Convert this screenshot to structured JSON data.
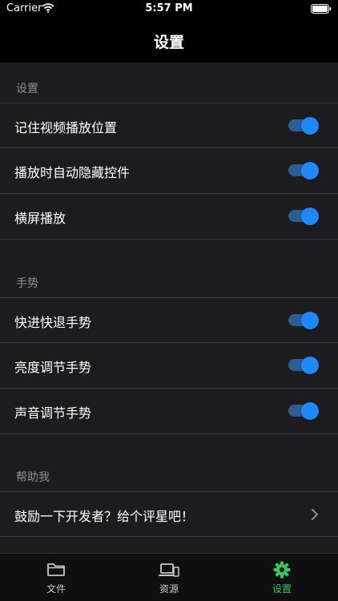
{
  "status_bar": {
    "carrier": "Carrier",
    "time": "5:57 PM"
  },
  "nav": {
    "title": "设置"
  },
  "sections": [
    {
      "header": "设置",
      "rows": [
        {
          "label": "记住视频播放位置",
          "on": true
        },
        {
          "label": "播放时自动隐藏控件",
          "on": true
        },
        {
          "label": "横屏播放",
          "on": true
        }
      ]
    },
    {
      "header": "手势",
      "rows": [
        {
          "label": "快进快退手势",
          "on": true
        },
        {
          "label": "亮度调节手势",
          "on": true
        },
        {
          "label": "声音调节手势",
          "on": true
        }
      ]
    },
    {
      "header": "帮助我",
      "rows": [
        {
          "label": "鼓励一下开发者？给个评星吧！"
        }
      ]
    }
  ],
  "tabs": [
    {
      "label": "文件",
      "icon": "folder-icon"
    },
    {
      "label": "资源",
      "icon": "devices-icon"
    },
    {
      "label": "设置",
      "icon": "gear-icon",
      "active": true
    }
  ],
  "colors": {
    "accent": "#1e88ff",
    "active_tab": "#33c85a",
    "background": "#1c1c1e"
  }
}
